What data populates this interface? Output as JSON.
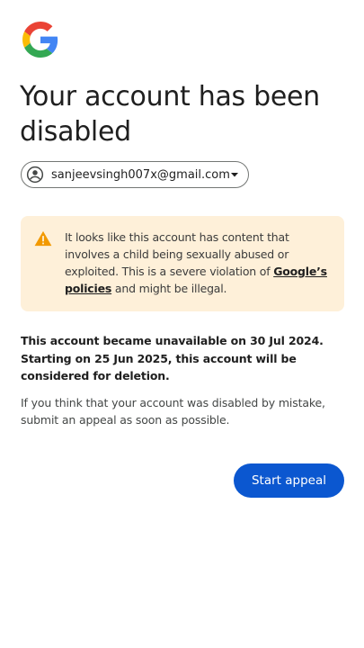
{
  "brand": {
    "logo_icon": "google-g-logo-icon",
    "colors": {
      "blue": "#4285F4",
      "red": "#EA4335",
      "yellow": "#FBBC05",
      "green": "#34A853"
    }
  },
  "header": {
    "title": "Your account has been disabled"
  },
  "account": {
    "email": "sanjeevsingh007x@gmail.com",
    "avatar_icon": "account-circle-icon",
    "dropdown_icon": "caret-down-icon"
  },
  "warning": {
    "icon": "warning-triangle-icon",
    "text_before_link": "It looks like this account has content that involves a child being sexually abused or exploited. This is a severe violation of ",
    "link_label": "Google’s policies",
    "text_after_link": " and might be illegal.",
    "background_color": "#fef0d9",
    "icon_color": "#f29900"
  },
  "status": {
    "message": "This account became unavailable on 30 Jul 2024. Starting on 25 Jun 2025, this account will be considered for deletion."
  },
  "appeal": {
    "message": "If you think that your account was disabled by mistake, submit an appeal as soon as possible.",
    "button_label": "Start appeal",
    "button_color": "#0b57d0"
  }
}
